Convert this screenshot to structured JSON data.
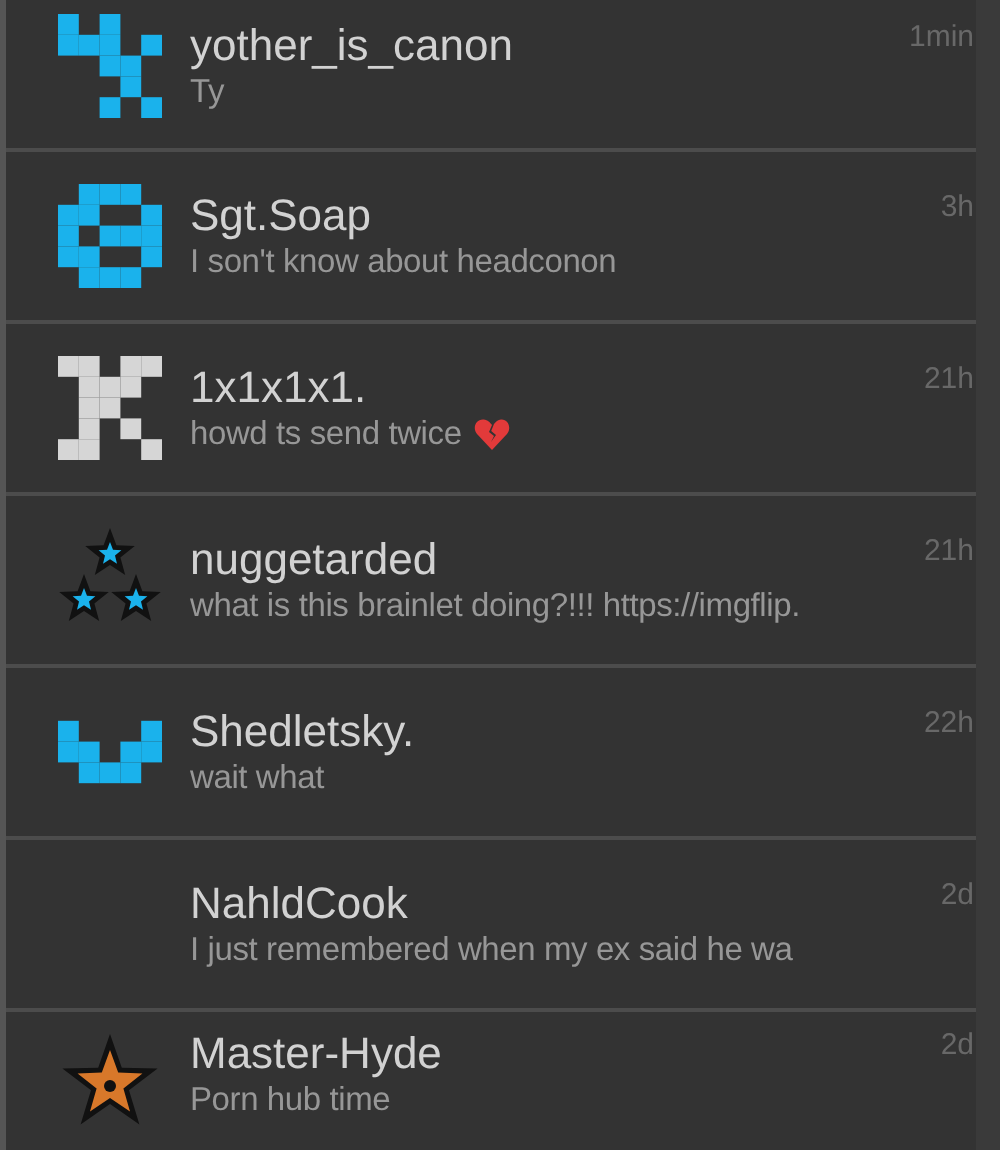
{
  "conversations": [
    {
      "kind": "checker",
      "name": "yother_is_canon",
      "preview": "Ty",
      "time": "1min"
    },
    {
      "kind": "bracket",
      "name": "Sgt.Soap",
      "preview": "I son't know about headconon",
      "time": "3h"
    },
    {
      "kind": "letter",
      "name": "1x1x1x1.",
      "preview": "howd ts send twice",
      "heart": true,
      "time": "21h"
    },
    {
      "kind": "stars",
      "name": "nuggetarded",
      "preview": "what is this brainlet doing?!!! https://imgflip.",
      "time": "21h"
    },
    {
      "kind": "smile",
      "name": "Shedletsky.",
      "preview": "wait what",
      "time": "22h"
    },
    {
      "kind": "none",
      "name": "NahldCook",
      "preview": "I just remembered when my ex said he wa",
      "time": "2d"
    },
    {
      "kind": "star",
      "name": "Master-Hyde",
      "preview": "Porn hub time",
      "time": "2d"
    }
  ]
}
